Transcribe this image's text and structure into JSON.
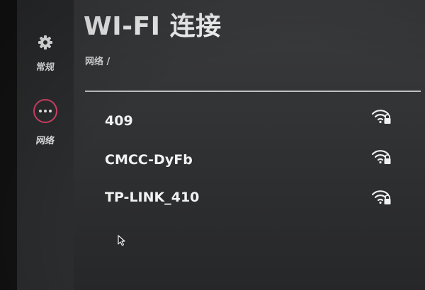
{
  "page": {
    "title": "WI-FI 连接",
    "breadcrumb": "网络 /"
  },
  "sidebar": {
    "items": [
      {
        "label": "常规",
        "icon": "gear-icon",
        "selected": false
      },
      {
        "label": "网络",
        "icon": "more-dots-icon",
        "selected": true
      }
    ]
  },
  "networks": [
    {
      "ssid": "409",
      "icon": "wifi-lock-icon",
      "secured": true
    },
    {
      "ssid": "CMCC-DyFb",
      "icon": "wifi-lock-icon",
      "secured": true
    },
    {
      "ssid": "TP-LINK_410",
      "icon": "wifi-lock-icon",
      "secured": true
    }
  ],
  "colors": {
    "accent": "#d9436a",
    "text": "#f2f2f2",
    "background": "#343537",
    "sidebar": "#2b2c2e"
  }
}
